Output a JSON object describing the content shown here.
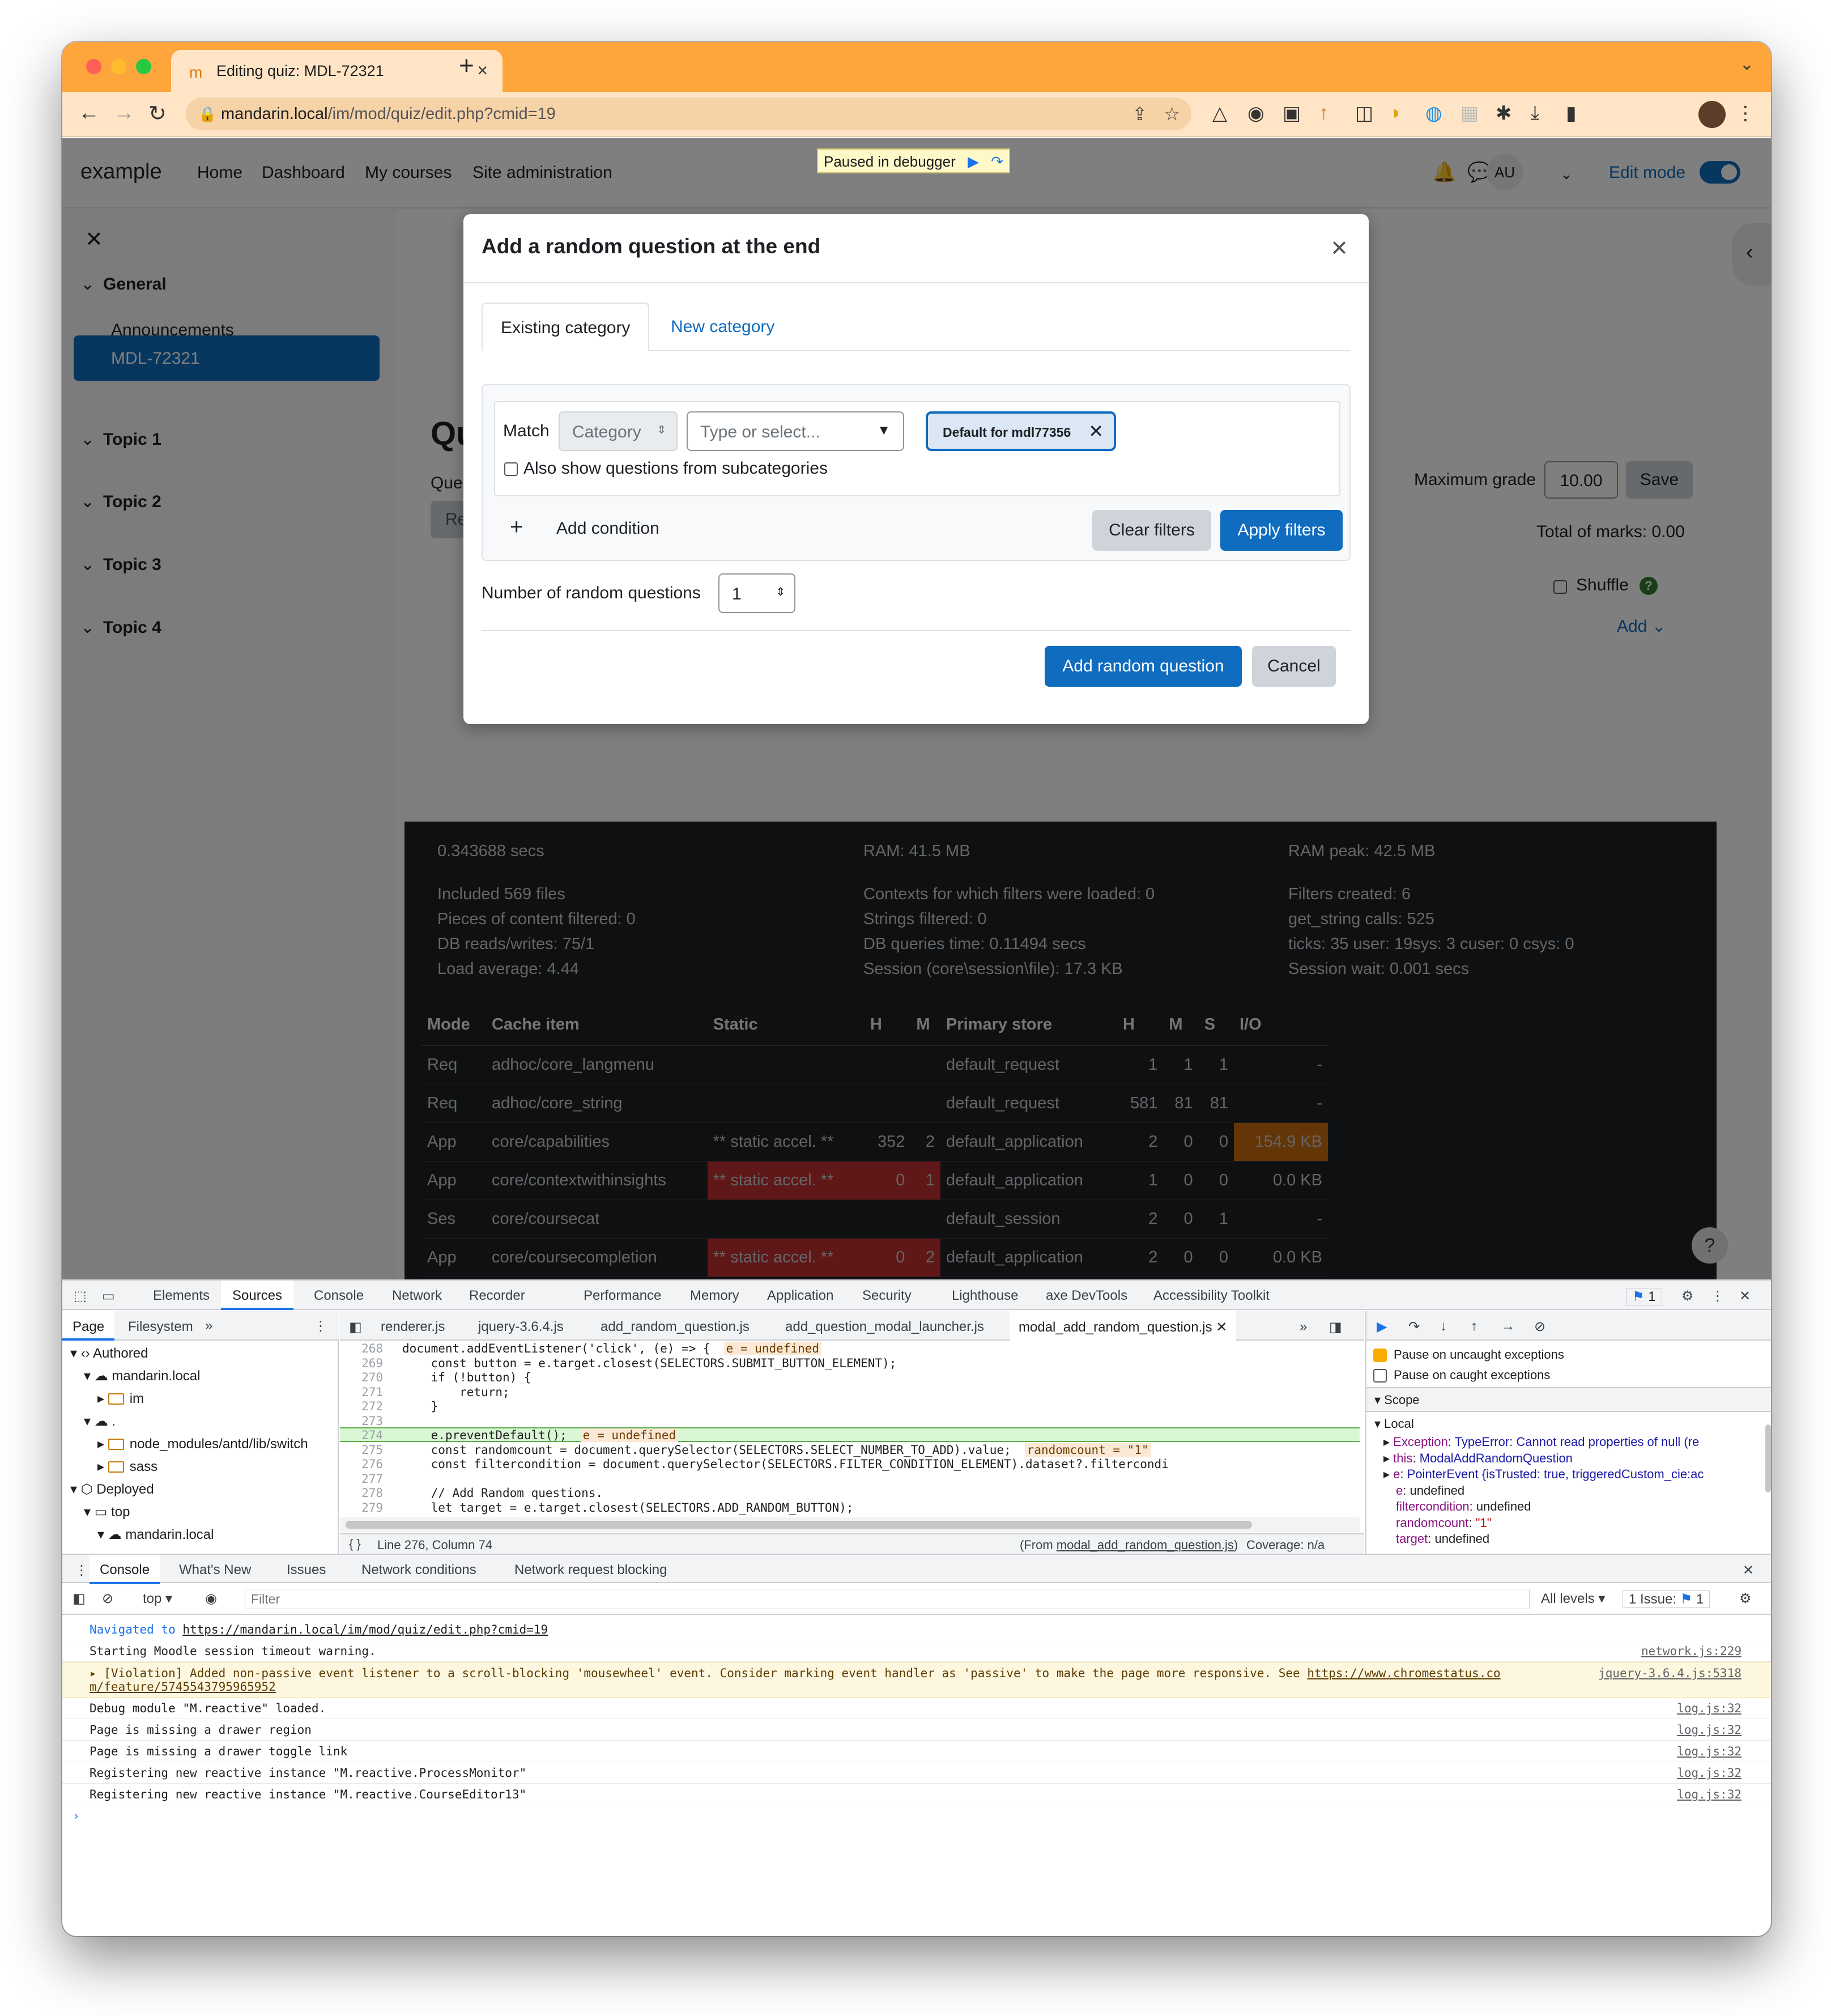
{
  "browser": {
    "tab_title": "Editing quiz: MDL-72321",
    "url_host": "mandarin.local",
    "url_path": "/im/mod/quiz/edit.php?cmid=19"
  },
  "site": {
    "brand": "example",
    "nav": [
      "Home",
      "Dashboard",
      "My courses",
      "Site administration"
    ],
    "user_initials": "AU",
    "edit_mode_label": "Edit mode"
  },
  "drawer": {
    "sections": [
      "General",
      "Topic 1",
      "Topic 2",
      "Topic 3",
      "Topic 4"
    ],
    "announcements": "Announcements",
    "active_item": "MDL-72321"
  },
  "content": {
    "heading_fragment": "Qu",
    "questions_fragment": "Que",
    "repaginate_fragment": "Re",
    "maximum_grade_label": "Maximum grade",
    "maximum_grade_value": "10.00",
    "save_label": "Save",
    "total_marks": "Total of marks: 0.00",
    "shuffle_label": "Shuffle",
    "add_label": "Add"
  },
  "debugger_banner": "Paused in debugger",
  "modal": {
    "title": "Add a random question at the end",
    "tabs": [
      "Existing category",
      "New category"
    ],
    "match_label": "Match",
    "category_select": "Category",
    "type_select_placeholder": "Type or select...",
    "chip": "Default for mdl77356",
    "subcategories_label": "Also show questions from subcategories",
    "add_condition": "Add condition",
    "clear_filters": "Clear filters",
    "apply_filters": "Apply filters",
    "number_label": "Number of random questions",
    "number_value": "1",
    "add_button": "Add random question",
    "cancel_button": "Cancel"
  },
  "perf": {
    "col1": [
      "0.343688 secs",
      "Included 569 files",
      "Pieces of content filtered: 0",
      "DB reads/writes: 75/1",
      "Load average: 4.44"
    ],
    "col2": [
      "RAM: 41.5 MB",
      "Contexts for which filters were loaded: 0",
      "Strings filtered: 0",
      "DB queries time: 0.11494 secs",
      "Session (core\\session\\file): 17.3 KB"
    ],
    "col3": [
      "RAM peak: 42.5 MB",
      "Filters created: 6",
      "get_string calls: 525",
      "ticks: 35 user: 19sys: 3 cuser: 0 csys: 0",
      "Session wait: 0.001 secs"
    ],
    "headers": [
      "Mode",
      "Cache item",
      "Static",
      "H",
      "M",
      "Primary store",
      "H",
      "M",
      "S",
      "I/O"
    ],
    "rows": [
      [
        "Req",
        "adhoc/core_langmenu",
        "",
        "",
        "",
        "default_request",
        "1",
        "1",
        "1",
        "-"
      ],
      [
        "Req",
        "adhoc/core_string",
        "",
        "",
        "",
        "default_request",
        "581",
        "81",
        "81",
        "-"
      ],
      [
        "App",
        "core/capabilities",
        "** static accel. **",
        "352",
        "2",
        "default_application",
        "2",
        "0",
        "0",
        "154.9 KB"
      ],
      [
        "App",
        "core/contextwithinsights",
        "** static accel. **",
        "0",
        "1",
        "default_application",
        "1",
        "0",
        "0",
        "0.0 KB"
      ],
      [
        "Ses",
        "core/coursecat",
        "",
        "",
        "",
        "default_session",
        "2",
        "0",
        "1",
        "-"
      ],
      [
        "App",
        "core/coursecompletion",
        "** static accel. **",
        "0",
        "2",
        "default_application",
        "2",
        "0",
        "0",
        "0.0 KB"
      ]
    ],
    "help": "?"
  },
  "devtools": {
    "tabs": [
      "Elements",
      "Sources",
      "Console",
      "Network",
      "Recorder",
      "Performance",
      "Memory",
      "Application",
      "Security",
      "Lighthouse",
      "axe DevTools",
      "Accessibility Toolkit"
    ],
    "issues_badge": "1",
    "nav_tabs": [
      "Page",
      "Filesystem"
    ],
    "tree": [
      "Authored",
      "mandarin.local",
      "im",
      ".",
      "node_modules/antd/lib/switch",
      "sass",
      "Deployed",
      "top",
      "mandarin.local"
    ],
    "file_tabs": [
      "renderer.js",
      "jquery-3.6.4.js",
      "add_random_question.js",
      "add_question_modal_launcher.js",
      "modal_add_random_question.js"
    ],
    "code": [
      {
        "n": "268",
        "t": "document.addEventListener('click', (e) => {",
        "v": "e = undefined"
      },
      {
        "n": "269",
        "t": "    const button = e.target.closest(SELECTORS.SUBMIT_BUTTON_ELEMENT);",
        "v": ""
      },
      {
        "n": "270",
        "t": "    if (!button) {",
        "v": ""
      },
      {
        "n": "271",
        "t": "        return;",
        "v": ""
      },
      {
        "n": "272",
        "t": "    }",
        "v": ""
      },
      {
        "n": "273",
        "t": "",
        "v": ""
      },
      {
        "n": "274",
        "t": "    e.preventDefault();",
        "v": "e = undefined"
      },
      {
        "n": "275",
        "t": "    const randomcount = document.querySelector(SELECTORS.SELECT_NUMBER_TO_ADD).value;",
        "v": "randomcount = \"1\""
      },
      {
        "n": "276",
        "t": "    const filtercondition = document.querySelector(SELECTORS.FILTER_CONDITION_ELEMENT).dataset?.filtercondi",
        "v": ""
      },
      {
        "n": "277",
        "t": "",
        "v": ""
      },
      {
        "n": "278",
        "t": "    // Add Random questions.",
        "v": ""
      },
      {
        "n": "279",
        "t": "    let target = e.target.closest(SELECTORS.ADD_RANDOM_BUTTON);",
        "v": ""
      }
    ],
    "status_position": "Line 276, Column 74",
    "status_from_prefix": "(From ",
    "status_from_file": "modal_add_random_question.js",
    "status_from_suffix": ")",
    "status_coverage": "Coverage: n/a",
    "pause_uncaught": "Pause on uncaught exceptions",
    "pause_caught": "Pause on caught exceptions",
    "scope": "Scope",
    "local": "Local",
    "scope_rows": [
      {
        "k": "Exception",
        "v": "TypeError: Cannot read properties of null (re"
      },
      {
        "k": "this",
        "v": "ModalAddRandomQuestion"
      },
      {
        "k": "e",
        "v": "PointerEvent {isTrusted: true, triggeredCustom_cie:ac"
      },
      {
        "k": "e",
        "v": "undefined"
      },
      {
        "k": "filtercondition",
        "v": "undefined"
      },
      {
        "k": "randomcount",
        "v": "\"1\""
      },
      {
        "k": "target",
        "v": "undefined"
      }
    ],
    "drawer_tabs": [
      "Console",
      "What's New",
      "Issues",
      "Network conditions",
      "Network request blocking"
    ],
    "context": "top",
    "filter_placeholder": "Filter",
    "levels": "All levels",
    "issue_count": "1 Issue:",
    "issue_badge": "1",
    "console": [
      {
        "msg": "Navigated to ",
        "link": "https://mandarin.local/im/mod/quiz/edit.php?cmid=19",
        "src": ""
      },
      {
        "msg": "Starting Moodle session timeout warning.",
        "link": "",
        "src": "network.js:229"
      },
      {
        "msg": "▸ [Violation] Added non-passive event listener to a scroll-blocking 'mousewheel' event. Consider marking event handler as 'passive' to make the page more responsive. See ",
        "link": "https://www.chromestatus.co",
        "link2": "m/feature/5745543795965952",
        "src": "jquery-3.6.4.js:5318"
      },
      {
        "msg": "Debug module \"M.reactive\" loaded.",
        "link": "",
        "src": "log.js:32"
      },
      {
        "msg": "Page is missing a drawer region",
        "link": "",
        "src": "log.js:32"
      },
      {
        "msg": "Page is missing a drawer toggle link",
        "link": "",
        "src": "log.js:32"
      },
      {
        "msg": "Registering new reactive instance \"M.reactive.ProcessMonitor\"",
        "link": "",
        "src": "log.js:32"
      },
      {
        "msg": "Registering new reactive instance \"M.reactive.CourseEditor13\"",
        "link": "",
        "src": "log.js:32"
      }
    ],
    "prompt": "›"
  }
}
